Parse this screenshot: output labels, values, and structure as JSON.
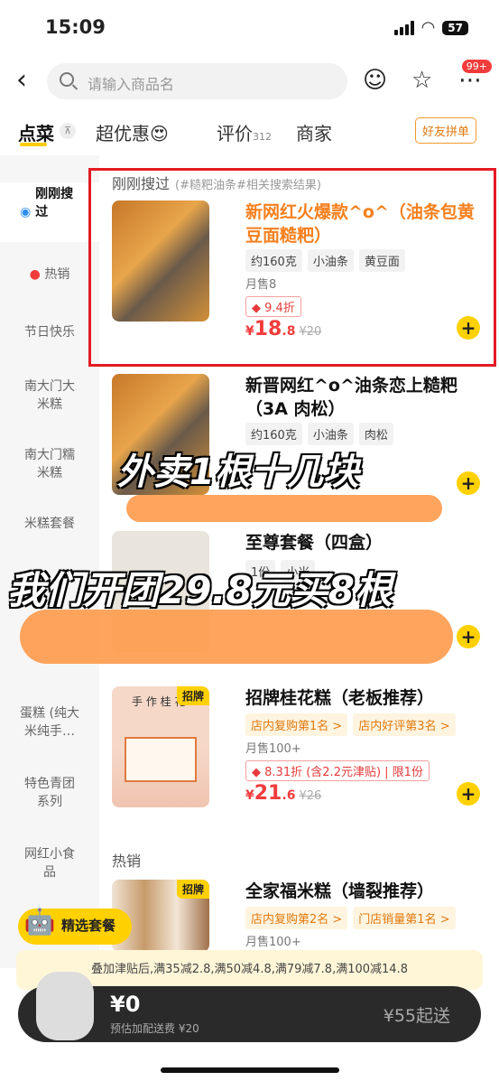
{
  "status": {
    "time": "15:09",
    "battery": "57"
  },
  "header": {
    "search_placeholder": "请输入商品名",
    "badge": "99+"
  },
  "tabs": [
    {
      "label": "点菜"
    },
    {
      "label": "超优惠"
    },
    {
      "label": "评价",
      "count": "312"
    },
    {
      "label": "商家"
    }
  ],
  "friend_button": "好友拼单",
  "sidebar": [
    {
      "label": "刚刚搜过"
    },
    {
      "label": "热销"
    },
    {
      "label": "节日快乐"
    },
    {
      "label": "南大门大米糕"
    },
    {
      "label": "南大门糯米糕"
    },
    {
      "label": "米糕套餐"
    },
    {
      "label": "蛋糕 (纯大米纯手…"
    },
    {
      "label": "特色青团系列"
    },
    {
      "label": "网红小食品"
    }
  ],
  "section_recent": {
    "title": "刚刚搜过",
    "hint": "(#糙粑油条#相关搜索结果)"
  },
  "section_hot": {
    "title": "热销"
  },
  "products": [
    {
      "name": "新网红火爆款^o^（油条包黄豆面糙粑）",
      "tags": [
        "约160克",
        "小油条",
        "黄豆面"
      ],
      "sold": "月售8",
      "discount": "9.4折",
      "price_int": "18",
      "price_dec": ".8",
      "old_price": "¥20"
    },
    {
      "name": "新晋网红^o^油条恋上糙粑（3A 肉松）",
      "tags": [
        "约160克",
        "小油条",
        "肉松"
      ]
    },
    {
      "name": "至尊套餐（四盒）",
      "tags": [
        "1份",
        "小米"
      ]
    },
    {
      "name": "招牌桂花糕（老板推荐）",
      "badge": "招牌",
      "rank_tags": [
        "店内复购第1名 >",
        "店内好评第3名 >"
      ],
      "sold": "月售100+",
      "discount": "8.31折 (含2.2元津贴) | 限1份",
      "price_int": "21",
      "price_dec": ".6",
      "old_price": "¥26",
      "image_caption": "手 作 桂 花"
    },
    {
      "name": "全家福米糕（墙裂推荐）",
      "badge": "招牌",
      "rank_tags": [
        "店内复购第2名 >",
        "门店销量第1名 >"
      ],
      "sold": "月售100+"
    }
  ],
  "overlay": {
    "line1": "外卖1根十几块",
    "line2": "我们开团29.8元买8根"
  },
  "bento_button": "精选套餐",
  "promo": "叠加津贴后,满35减2.8,满50减4.8,满79减7.8,满100减14.8",
  "cart": {
    "amount": "¥0",
    "fee": "预估加配送费 ¥20",
    "min_order": "¥55起送"
  },
  "colors": {
    "accent": "#ffd100",
    "price": "#f23c3c",
    "highlight_border": "#e41b23"
  }
}
